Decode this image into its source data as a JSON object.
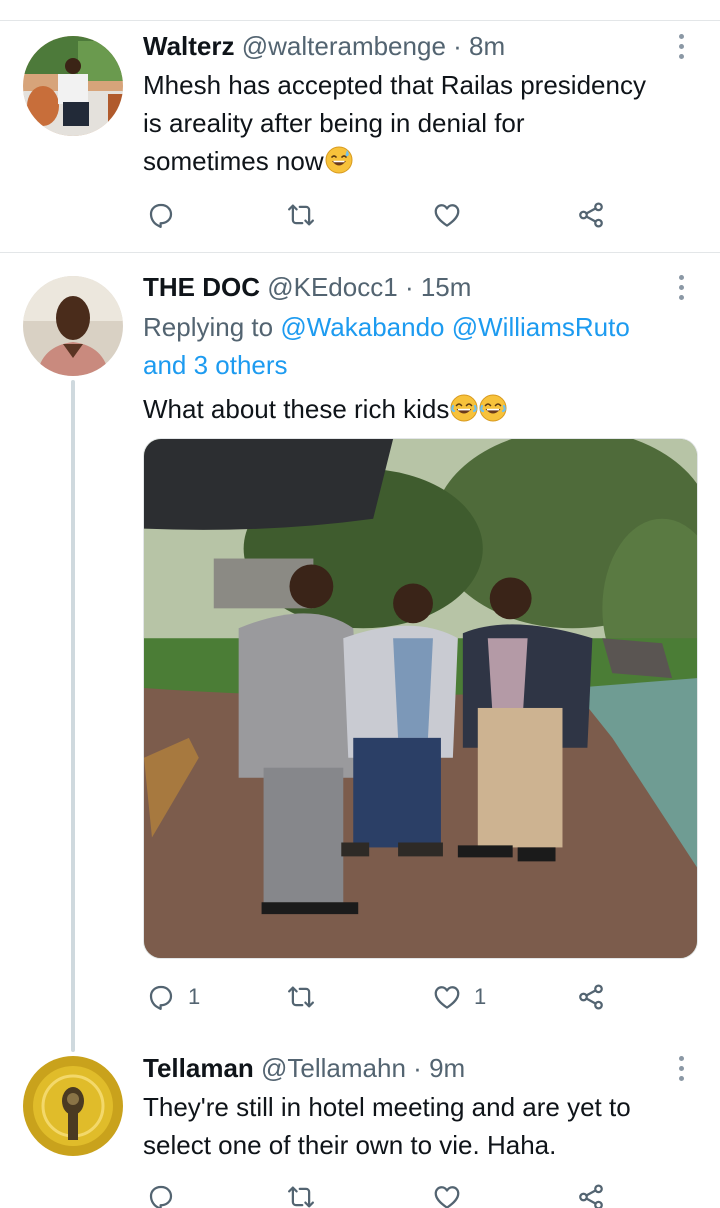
{
  "tweets": [
    {
      "name": "Walterz",
      "handle": "@walterambenge",
      "separator": "·",
      "time": "8m",
      "text_lines": [
        "Mhesh has accepted that Railas presidency",
        "is areality after being in denial for",
        "sometimes now"
      ],
      "emoji": "sweat-smile-emoji",
      "actions": {
        "reply": "",
        "retweet": "",
        "like": ""
      }
    },
    {
      "name": "THE DOC",
      "handle": "@KEdocc1",
      "separator": "·",
      "time": "15m",
      "replying_prefix": "Replying to",
      "replying_to": [
        "@Wakabando",
        "@WilliamsRuto"
      ],
      "replying_more": "and 3 others",
      "text": "What about these rich kids",
      "emoji": "joy-emoji",
      "photo": "three-men-standing-by-pool",
      "actions": {
        "reply": "1",
        "retweet": "",
        "like": "1"
      }
    },
    {
      "name": "Tellaman",
      "handle": "@Tellamahn",
      "separator": "·",
      "time": "9m",
      "text_lines": [
        "They're still in hotel meeting and are yet to",
        "select one of their own to vie. Haha."
      ],
      "actions": {
        "reply": "",
        "retweet": "",
        "like": ""
      }
    }
  ],
  "colors": {
    "text": "#0f1419",
    "secondary": "#536471",
    "link": "#1d9bf0",
    "divider": "#e3e6e8",
    "thread_line": "#cfd9de"
  }
}
